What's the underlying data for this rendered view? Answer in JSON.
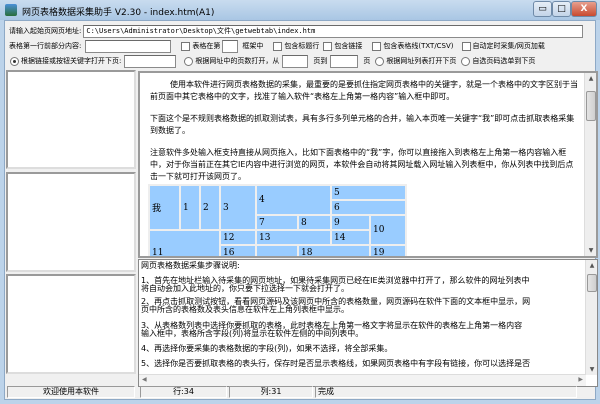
{
  "window": {
    "title": "网页表格数据采集助手 V2.30 - index.htm(A1)",
    "minimize": "▭",
    "maximize": "□",
    "close": "X"
  },
  "toolbar": {
    "url_label": "请输入起始页网页地址:",
    "url_value": "C:\\Users\\Administrator\\Desktop\\文件\\getwebtab\\index.htm",
    "first_row_label": "表格第一行前部分内容:",
    "first_row_value": "",
    "table_in_label": "表格在第",
    "frame_value": "",
    "frame_suffix": "框架中",
    "include_header": "包含标题行",
    "include_links": "包含链接",
    "include_gridlines": "包含表格线(TXT/CSV)",
    "auto_collect": "自动定时采集/网页加载",
    "radio_keyword": "根据链接或按钮关键字打开下页:",
    "keyword_value": "",
    "radio_pagenum": "根据网址中的页数打开，从",
    "page_from": "",
    "page_to_label": "页到",
    "page_to": "",
    "page_suffix": "页",
    "radio_urllist": "根据网址列表打开下页",
    "radio_autoselect": "自选页码选单到下页",
    "selected_radio": "keyword"
  },
  "browser": {
    "para1": "使用本软件进行网页表格数据的采集，最重要的是要抓住指定网页表格中的关键字，就是一个表格中的文字区别于当前页面中其它表格中的文字，找准了输入软件“表格左上角第一格内容”输入框中即可。",
    "para2": "下面这个是不规则表格数据的抓取测试表，具有多行多列单元格的合并，输入本页唯一关键字“我”即可点击抓取表格采集到数据了。",
    "para3": "注意软件多处输入框支持直接从网页拖入，比如下面表格中的“我”字，你可以直接拖入到表格左上角第一格内容输入框中，对于你当前正在其它IE内容中进行浏览的网页，本软件会自动将其网址载入网址输入列表框中，你从列表中找到后点击一下就可打开该网页了。",
    "cells": [
      "我",
      "1",
      "2",
      "3",
      "4",
      "5",
      "6",
      "7",
      "8",
      "9",
      "10",
      "11",
      "12",
      "13",
      "14",
      "16",
      "",
      "18",
      "19"
    ],
    "cell_color": "#99ccff"
  },
  "notes": {
    "heading": "网页表格数据采集步骤说明:",
    "steps": [
      "1、首先在地址栏输入待采集的网页地址，如果待采集网页已经在IE类浏览器中打开了，那么软件的网址列表中",
      "    将自动会加入此地址的，你只要下拉选择一下就会打开了。",
      "2、再点击抓取测试按钮，看看网页源码及该网页中所含的表格数量，网页源码在软件下面的文本框中显示，网",
      "    页中所含的表格数及表头信息在软件左上角列表框中显示。",
      "3、从表格数列表中选择你要抓取的表格，此时表格左上角第一格文字将显示在软件的表格左上角第一格内容",
      "    输入框中，表格所含字段(列)将显示在软件左侧的中间列表中。",
      "4、再选择你要采集的表格数据的字段(列)，如果不选择，将全部采集。",
      "5、选择你是否要抓取表格的表头行，保存时是否显示表格线，如果网页表格中有字段有链接，你可以选择是否"
    ]
  },
  "statusbar": {
    "welcome": "欢迎使用本软件",
    "row": "行:34",
    "col": "列:31",
    "state": "完成"
  }
}
